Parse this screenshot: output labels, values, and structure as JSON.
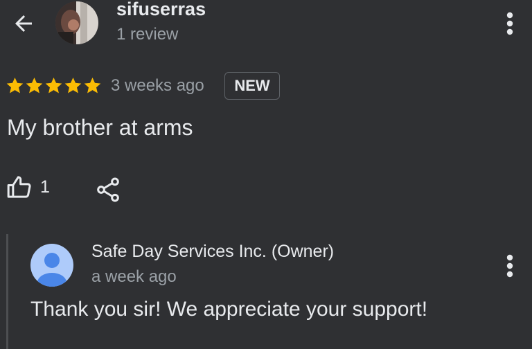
{
  "header": {
    "username": "sifuserras",
    "review_count": "1 review"
  },
  "review": {
    "rating": 5,
    "rating_max": 5,
    "time_ago": "3 weeks ago",
    "badge": "NEW",
    "text": "My brother at arms",
    "like_count": "1"
  },
  "owner_reply": {
    "name": "Safe Day Services Inc. (Owner)",
    "time_ago": "a week ago",
    "text": "Thank you sir! We appreciate your support!"
  },
  "colors": {
    "background": "#2f3033",
    "star": "#fbbc04",
    "owner_avatar_bg": "#aecbfa",
    "owner_avatar_fg": "#4a86e8"
  }
}
